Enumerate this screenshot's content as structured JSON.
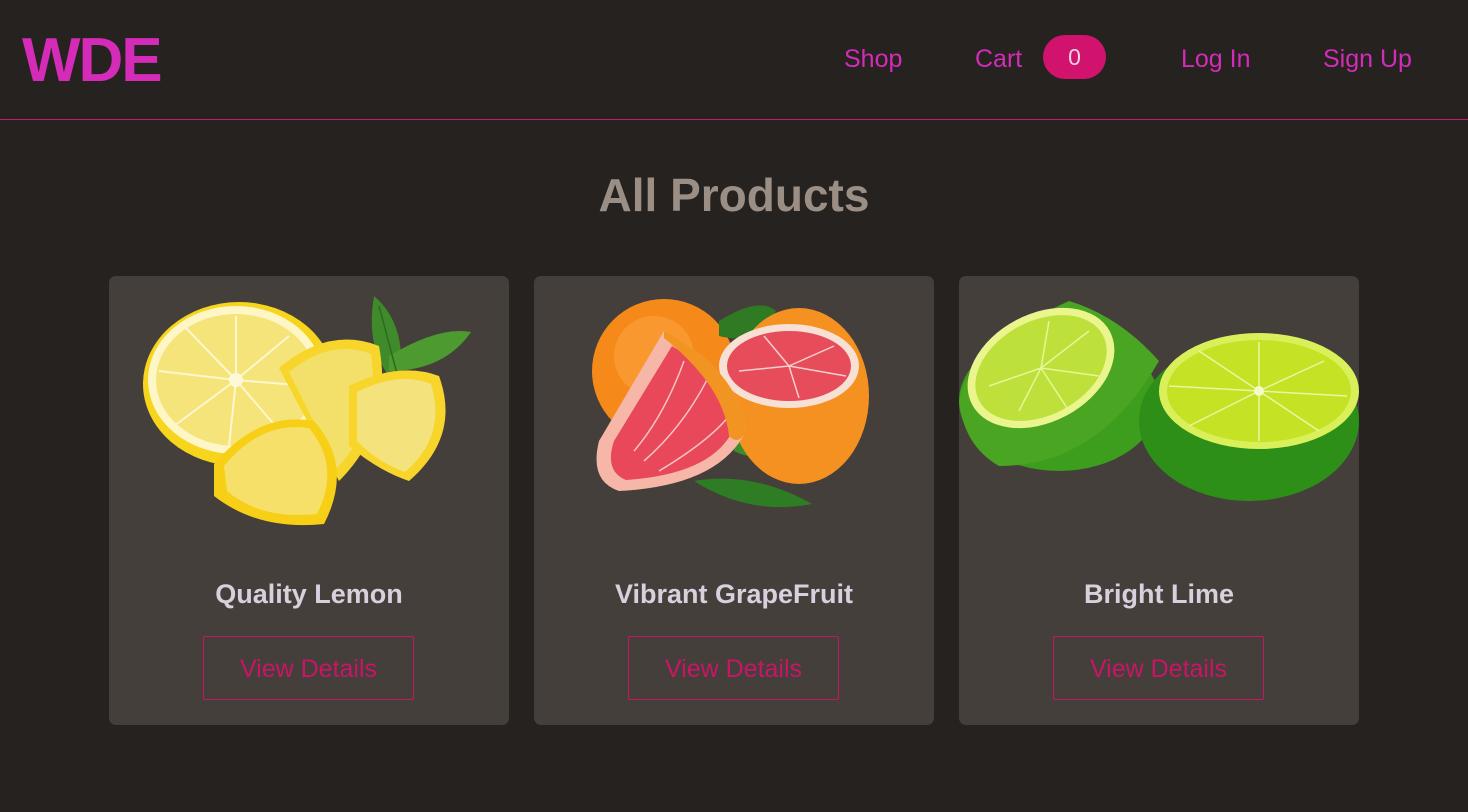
{
  "brand": {
    "logo": "WDE"
  },
  "nav": {
    "shop": "Shop",
    "cart": "Cart",
    "cart_count": "0",
    "login": "Log In",
    "signup": "Sign Up"
  },
  "page": {
    "title": "All Products"
  },
  "products": [
    {
      "name": "Quality Lemon",
      "button": "View Details",
      "image": "lemon-image"
    },
    {
      "name": "Vibrant GrapeFruit",
      "button": "View Details",
      "image": "grapefruit-image"
    },
    {
      "name": "Bright Lime",
      "button": "View Details",
      "image": "lime-image"
    }
  ],
  "colors": {
    "accent": "#d42bb8",
    "badge": "#d1136e",
    "button": "#c81565",
    "background": "#252220",
    "card": "#443f3a",
    "title": "#9b8f85"
  }
}
